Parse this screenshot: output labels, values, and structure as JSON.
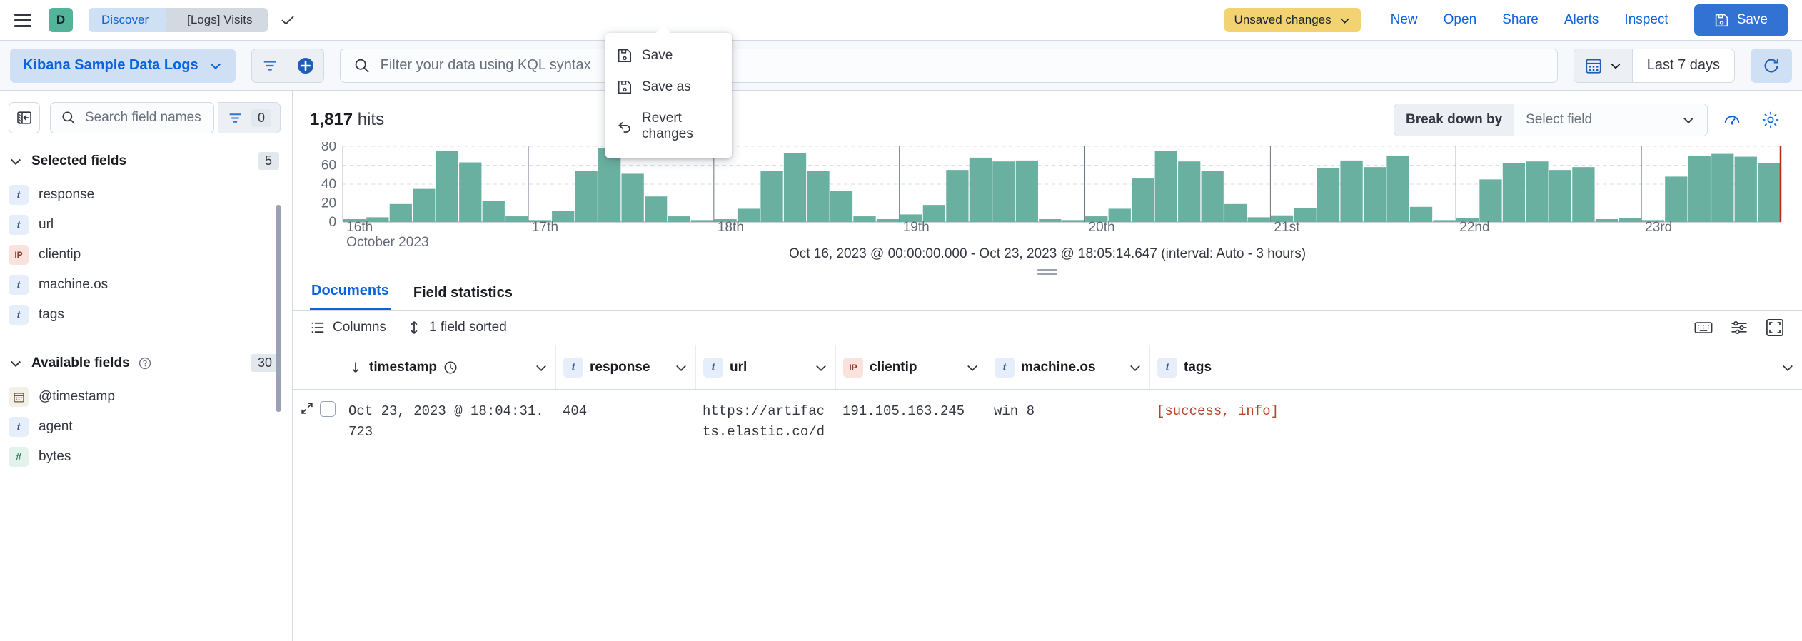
{
  "topnav": {
    "menu_icon": "hamburger-menu-icon",
    "space_initial": "D",
    "breadcrumbs": [
      {
        "label": "Discover"
      },
      {
        "label": "[Logs] Visits"
      }
    ],
    "check_icon": "check-icon",
    "unsaved_badge": "Unsaved changes",
    "links": [
      {
        "label": "New"
      },
      {
        "label": "Open"
      },
      {
        "label": "Share"
      },
      {
        "label": "Alerts"
      },
      {
        "label": "Inspect"
      }
    ],
    "save_button": "Save",
    "colors": {
      "accent": "#0b64dd",
      "primary_button": "#3172d3",
      "warning": "#f3d371",
      "space_avatar": "#54b399"
    }
  },
  "popover": {
    "items": [
      {
        "label": "Save",
        "icon": "save-disk-icon"
      },
      {
        "label": "Save as",
        "icon": "save-as-disk-icon"
      },
      {
        "label": "Revert changes",
        "icon": "revert-arrow-icon"
      }
    ]
  },
  "querybar": {
    "data_view": "Kibana Sample Data Logs",
    "filter_icon": "filter-lines-icon",
    "add_filter_icon": "add-circle-icon",
    "search_icon": "search-icon",
    "kql_placeholder": "Filter your data using KQL syntax",
    "kql_value": "",
    "calendar_icon": "calendar-icon",
    "date_range": "Last 7 days",
    "refresh_icon": "refresh-icon"
  },
  "sidebar": {
    "collapse_icon": "collapse-panel-icon",
    "search_placeholder": "Search field names",
    "search_value": "",
    "field_filter_icon": "filter-lines-icon",
    "field_filter_count": "0",
    "sections": [
      {
        "title": "Selected fields",
        "count": "5",
        "fields": [
          {
            "name": "response",
            "type": "t"
          },
          {
            "name": "url",
            "type": "t"
          },
          {
            "name": "clientip",
            "type": "IP"
          },
          {
            "name": "machine.os",
            "type": "t"
          },
          {
            "name": "tags",
            "type": "t"
          }
        ]
      },
      {
        "title": "Available fields",
        "count": "30",
        "help_icon": "question-circle-icon",
        "fields": [
          {
            "name": "@timestamp",
            "type": "date"
          },
          {
            "name": "agent",
            "type": "t"
          },
          {
            "name": "bytes",
            "type": "#"
          }
        ]
      }
    ]
  },
  "main": {
    "hits_count": "1,817",
    "hits_label": "hits",
    "breakdown_label": "Break down by",
    "breakdown_value": "Select field",
    "chart_options_icon": "chart-options-icon",
    "settings_icon": "gear-icon",
    "timerange": "Oct 16, 2023 @ 00:00:00.000 - Oct 23, 2023 @ 18:05:14.647 (interval: Auto - 3 hours)",
    "tabs": [
      {
        "label": "Documents",
        "active": true
      },
      {
        "label": "Field statistics",
        "active": false
      }
    ],
    "toolbar": {
      "columns_label": "Columns",
      "columns_icon": "list-icon",
      "sort_label": "1 field sorted",
      "sort_icon": "sort-updown-icon",
      "keyboard_icon": "keyboard-icon",
      "display_icon": "display-options-icon",
      "fullscreen_icon": "fullscreen-icon"
    }
  },
  "chart_data": {
    "type": "bar",
    "title": "",
    "xlabel": "October 2023",
    "ylabel": "",
    "ylim": [
      0,
      80
    ],
    "yticks": [
      0,
      20,
      40,
      60,
      80
    ],
    "grid": true,
    "bar_color": "#6ab0a0",
    "last_bar_marker_color": "#bd271e",
    "xticks": [
      "16th",
      "17th",
      "18th",
      "19th",
      "20th",
      "21st",
      "22nd",
      "23rd"
    ],
    "x_sublabel": "October 2023",
    "interval": "Auto - 3 hours",
    "values": [
      3,
      5,
      19,
      35,
      75,
      63,
      22,
      6,
      2,
      12,
      54,
      78,
      51,
      27,
      6,
      2,
      3,
      14,
      54,
      73,
      54,
      33,
      6,
      3,
      8,
      18,
      55,
      68,
      64,
      65,
      3,
      2,
      6,
      14,
      46,
      75,
      64,
      54,
      19,
      5,
      7,
      15,
      57,
      65,
      58,
      70,
      16,
      2,
      4,
      45,
      62,
      64,
      55,
      58,
      3,
      4,
      2,
      48,
      70,
      72,
      69,
      62
    ]
  },
  "grid": {
    "columns": [
      {
        "label": "timestamp",
        "type": null,
        "icon": "clock-icon",
        "sorted": true,
        "sort_dir": "desc"
      },
      {
        "label": "response",
        "type": "t"
      },
      {
        "label": "url",
        "type": "t"
      },
      {
        "label": "clientip",
        "type": "IP"
      },
      {
        "label": "machine.os",
        "type": "t"
      },
      {
        "label": "tags",
        "type": "t"
      }
    ],
    "rows": [
      {
        "timestamp": "Oct 23, 2023 @ 18:04:31.723",
        "response": "404",
        "url": "https://artifacts.elastic.co/d",
        "clientip": "191.105.163.245",
        "machine_os": "win 8",
        "tags": "[success, info]"
      }
    ]
  }
}
